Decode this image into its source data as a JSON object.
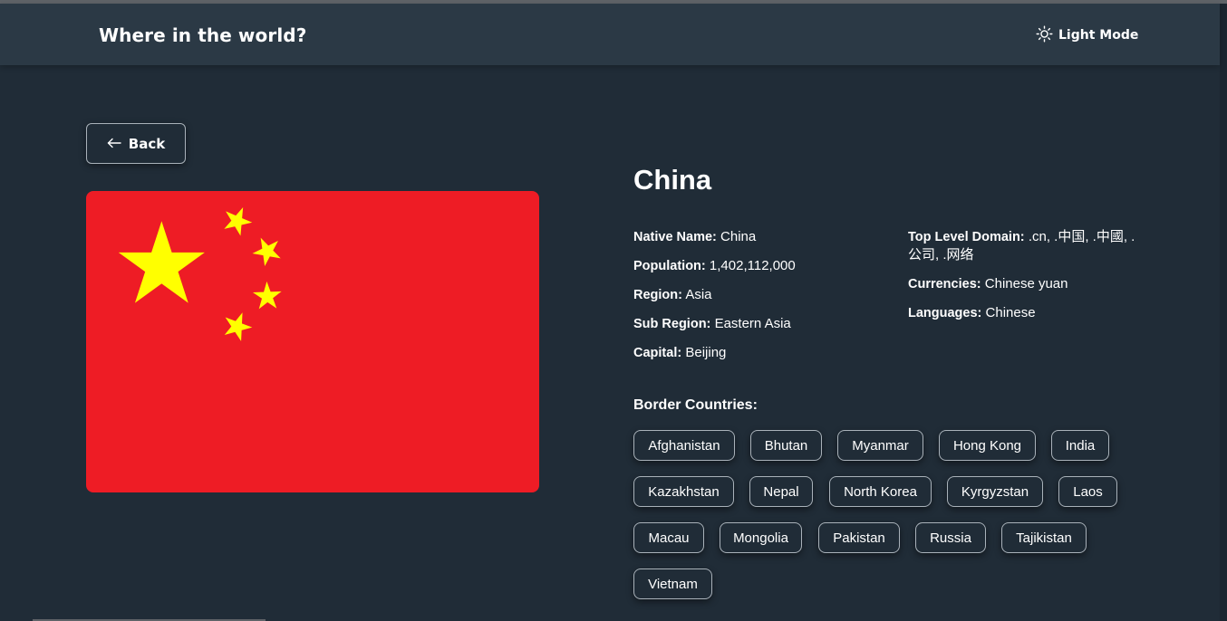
{
  "header": {
    "title": "Where in the world?",
    "theme_label": "Light Mode",
    "theme_icon": "sun-icon"
  },
  "back_button": {
    "label": "Back",
    "icon": "arrow-left-icon"
  },
  "flag": {
    "alt": "China flag",
    "colors": {
      "field": "#ee1c25",
      "stars": "#ffff00"
    }
  },
  "country": {
    "name": "China",
    "details_left": [
      {
        "label": "Native Name:",
        "value": "China"
      },
      {
        "label": "Population:",
        "value": "1,402,112,000"
      },
      {
        "label": "Region:",
        "value": "Asia"
      },
      {
        "label": "Sub Region:",
        "value": "Eastern Asia"
      },
      {
        "label": "Capital:",
        "value": "Beijing"
      }
    ],
    "details_right": [
      {
        "label": "Top Level Domain:",
        "value": ".cn, .中国, .中國, .公司, .网络"
      },
      {
        "label": "Currencies:",
        "value": "Chinese yuan"
      },
      {
        "label": "Languages:",
        "value": "Chinese"
      }
    ]
  },
  "borders": {
    "title": "Border Countries:",
    "countries": [
      "Afghanistan",
      "Bhutan",
      "Myanmar",
      "Hong Kong",
      "India",
      "Kazakhstan",
      "Nepal",
      "North Korea",
      "Kyrgyzstan",
      "Laos",
      "Macau",
      "Mongolia",
      "Pakistan",
      "Russia",
      "Tajikistan",
      "Vietnam"
    ]
  },
  "colors": {
    "background": "#202c37",
    "header": "#2b3945",
    "text": "#ffffff"
  }
}
